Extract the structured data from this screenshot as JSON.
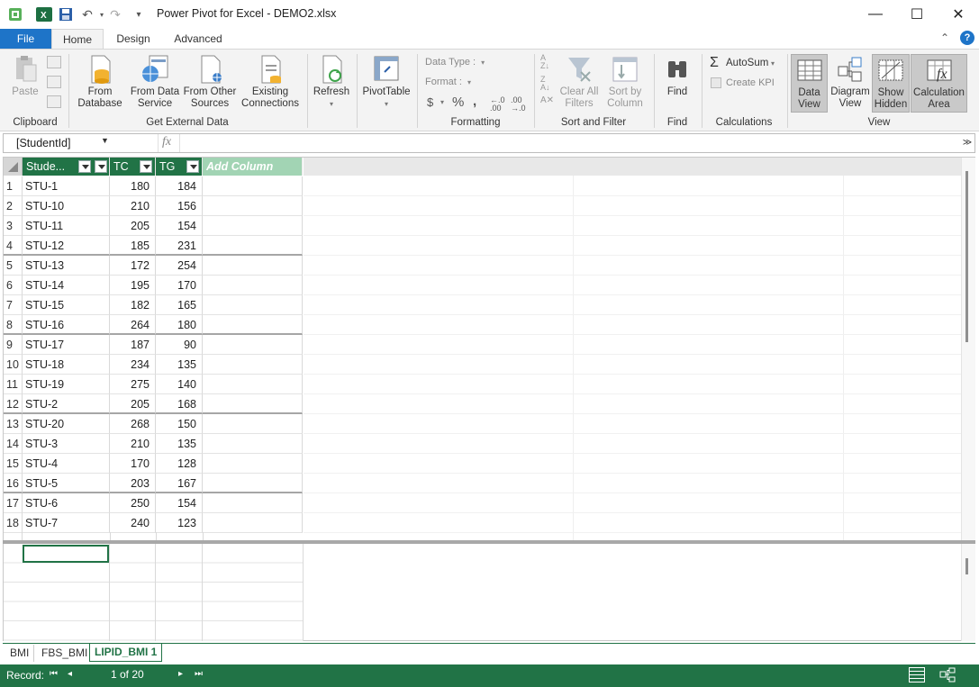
{
  "window": {
    "title": "Power Pivot for Excel - DEMO2.xlsx",
    "minimize": "—",
    "maximize": "☐",
    "close": "✕"
  },
  "tabs": {
    "file": "File",
    "home": "Home",
    "design": "Design",
    "advanced": "Advanced"
  },
  "ribbon": {
    "clipboard": {
      "paste": "Paste",
      "label": "Clipboard"
    },
    "external": {
      "from_database": [
        "From",
        "Database"
      ],
      "from_data_service": [
        "From Data",
        "Service"
      ],
      "from_other_sources": [
        "From Other",
        "Sources"
      ],
      "existing_connections": [
        "Existing",
        "Connections"
      ],
      "label": "Get External Data"
    },
    "refresh": "Refresh",
    "pivottable": "PivotTable",
    "formatting": {
      "data_type": "Data Type :",
      "format": "Format :",
      "currency": "$",
      "percent": "%",
      "comma": "ܸ",
      "label": "Formatting"
    },
    "sort_filter": {
      "clear_all_filters": [
        "Clear All",
        "Filters"
      ],
      "sort_by_column": [
        "Sort by",
        "Column"
      ],
      "label": "Sort and Filter"
    },
    "find": {
      "find": "Find",
      "label": "Find"
    },
    "calculations": {
      "autosum": "AutoSum",
      "create_kpi": "Create KPI",
      "label": "Calculations"
    },
    "view": {
      "data_view": [
        "Data",
        "View"
      ],
      "diagram_view": [
        "Diagram",
        "View"
      ],
      "show_hidden": [
        "Show",
        "Hidden"
      ],
      "calculation_area": [
        "Calculation",
        "Area"
      ],
      "label": "View"
    }
  },
  "formula_bar": {
    "name_box": "[StudentId]",
    "fx": "fx"
  },
  "columns": [
    "Stude...",
    "TC",
    "TG",
    "Add Column"
  ],
  "rows": [
    [
      "1",
      "STU-1",
      "180",
      "184"
    ],
    [
      "2",
      "STU-10",
      "210",
      "156"
    ],
    [
      "3",
      "STU-11",
      "205",
      "154"
    ],
    [
      "4",
      "STU-12",
      "185",
      "231"
    ],
    [
      "5",
      "STU-13",
      "172",
      "254"
    ],
    [
      "6",
      "STU-14",
      "195",
      "170"
    ],
    [
      "7",
      "STU-15",
      "182",
      "165"
    ],
    [
      "8",
      "STU-16",
      "264",
      "180"
    ],
    [
      "9",
      "STU-17",
      "187",
      "90"
    ],
    [
      "10",
      "STU-18",
      "234",
      "135"
    ],
    [
      "11",
      "STU-19",
      "275",
      "140"
    ],
    [
      "12",
      "STU-2",
      "205",
      "168"
    ],
    [
      "13",
      "STU-20",
      "268",
      "150"
    ],
    [
      "14",
      "STU-3",
      "210",
      "135"
    ],
    [
      "15",
      "STU-4",
      "170",
      "128"
    ],
    [
      "16",
      "STU-5",
      "203",
      "167"
    ],
    [
      "17",
      "STU-6",
      "250",
      "154"
    ],
    [
      "18",
      "STU-7",
      "240",
      "123"
    ]
  ],
  "sheet_tabs": [
    "BMI",
    "FBS_BMI",
    "LIPID_BMI 1"
  ],
  "status": {
    "record_label": "Record:",
    "position": "1 of 20"
  },
  "colors": {
    "accent": "#217346",
    "file_tab": "#1e74c8"
  }
}
